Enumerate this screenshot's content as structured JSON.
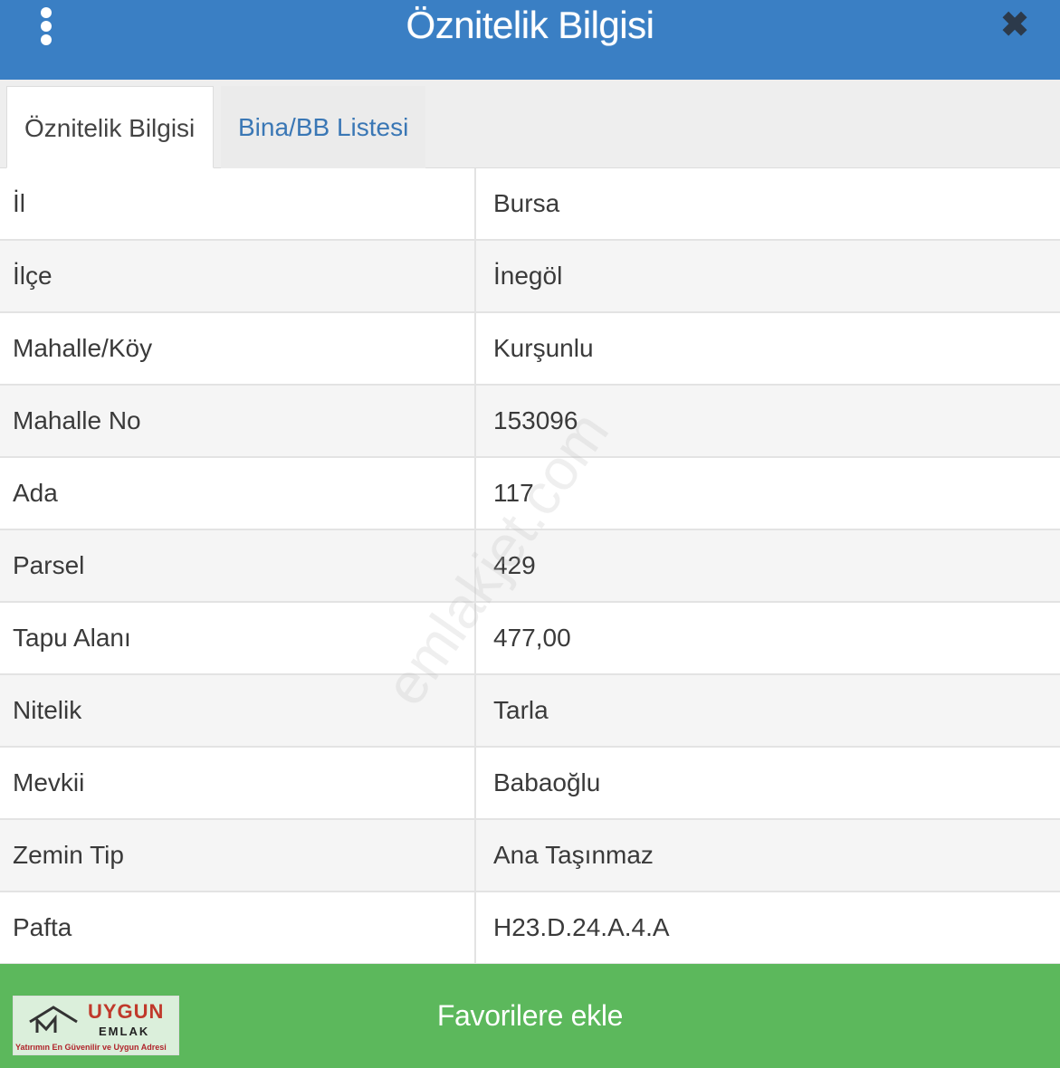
{
  "header": {
    "title": "Öznitelik Bilgisi",
    "menu_icon": "more-vertical-icon",
    "close_icon": "close-icon",
    "close_glyph": "✖",
    "accent_color": "#3a7fc4"
  },
  "tabs": [
    {
      "label": "Öznitelik Bilgisi",
      "active": true
    },
    {
      "label": "Bina/BB Listesi",
      "active": false
    }
  ],
  "attributes": [
    {
      "key": "İl",
      "value": "Bursa"
    },
    {
      "key": "İlçe",
      "value": "İnegöl"
    },
    {
      "key": "Mahalle/Köy",
      "value": "Kurşunlu"
    },
    {
      "key": "Mahalle No",
      "value": "153096"
    },
    {
      "key": "Ada",
      "value": "117"
    },
    {
      "key": "Parsel",
      "value": "429"
    },
    {
      "key": "Tapu Alanı",
      "value": "477,00"
    },
    {
      "key": "Nitelik",
      "value": "Tarla"
    },
    {
      "key": "Mevkii",
      "value": "Babaoğlu"
    },
    {
      "key": "Zemin Tip",
      "value": "Ana Taşınmaz"
    },
    {
      "key": "Pafta",
      "value": "H23.D.24.A.4.A"
    }
  ],
  "footer": {
    "button_label": "Favorilere ekle",
    "button_color": "#5cb85c"
  },
  "logo": {
    "name": "UYGUN",
    "sub": "EMLAK",
    "tagline": "Yatırımın En Güvenilir ve Uygun Adresi"
  },
  "watermark": {
    "text": "emlakjet.com"
  }
}
